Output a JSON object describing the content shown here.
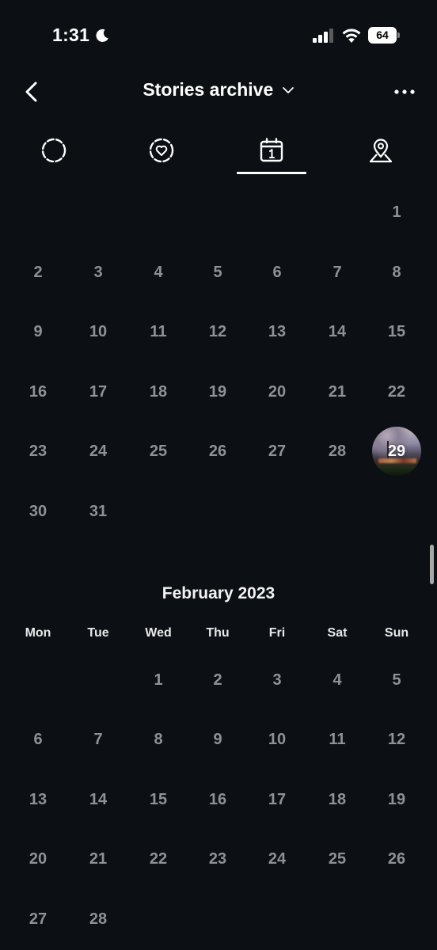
{
  "status_bar": {
    "time": "1:31",
    "battery": "64"
  },
  "header": {
    "title": "Stories archive"
  },
  "tabs": [
    {
      "name": "stories-tab",
      "icon": "dashed-circle-icon"
    },
    {
      "name": "highlights-tab",
      "icon": "heart-circle-icon"
    },
    {
      "name": "calendar-tab",
      "icon": "calendar-icon",
      "active": true
    },
    {
      "name": "location-tab",
      "icon": "map-pin-icon"
    }
  ],
  "colors": {
    "background": "#0c1014",
    "day_text": "#8e9196",
    "text": "#ffffff"
  },
  "january": {
    "days": [
      "1",
      "2",
      "3",
      "4",
      "5",
      "6",
      "7",
      "8",
      "9",
      "10",
      "11",
      "12",
      "13",
      "14",
      "15",
      "16",
      "17",
      "18",
      "19",
      "20",
      "21",
      "22",
      "23",
      "24",
      "25",
      "26",
      "27",
      "28",
      "29",
      "30",
      "31"
    ],
    "story_day": "29"
  },
  "february": {
    "title": "February 2023",
    "weekdays": [
      "Mon",
      "Tue",
      "Wed",
      "Thu",
      "Fri",
      "Sat",
      "Sun"
    ],
    "days": [
      "1",
      "2",
      "3",
      "4",
      "5",
      "6",
      "7",
      "8",
      "9",
      "10",
      "11",
      "12",
      "13",
      "14",
      "15",
      "16",
      "17",
      "18",
      "19",
      "20",
      "21",
      "22",
      "23",
      "24",
      "25",
      "26",
      "27",
      "28"
    ]
  }
}
